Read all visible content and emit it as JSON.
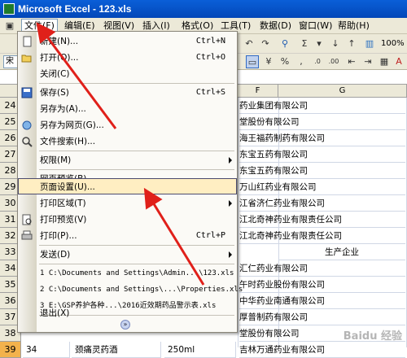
{
  "window": {
    "title": "Microsoft Excel - 123.xls"
  },
  "menubar": {
    "items": [
      {
        "label": "文件(F)"
      },
      {
        "label": "编辑(E)"
      },
      {
        "label": "视图(V)"
      },
      {
        "label": "插入(I)"
      },
      {
        "label": "格式(O)"
      },
      {
        "label": "工具(T)"
      },
      {
        "label": "数据(D)"
      },
      {
        "label": "窗口(W)"
      },
      {
        "label": "帮助(H)"
      }
    ]
  },
  "toolbar": {
    "zoom": "100%",
    "font_name": "宋",
    "sum_symbol": "Σ",
    "percent": "%",
    "comma": ","
  },
  "sheet": {
    "columns": [
      "F",
      "G"
    ],
    "rows": [
      {
        "num": "24",
        "text": "药业集团有限公司"
      },
      {
        "num": "25",
        "text": "堂股份有限公司"
      },
      {
        "num": "26",
        "text": "海王福药制药有限公司"
      },
      {
        "num": "27",
        "text": "东宝五药有限公司"
      },
      {
        "num": "28",
        "text": "东宝五药有限公司"
      },
      {
        "num": "29",
        "text": "万山红药业有限公司"
      },
      {
        "num": "30",
        "text": "江省济仁药业有限公司"
      },
      {
        "num": "31",
        "text": "江北奇神药业有限责任公司"
      },
      {
        "num": "32",
        "text": "江北奇神药业有限责任公司"
      },
      {
        "num": "33",
        "text": "生产企业"
      },
      {
        "num": "34",
        "text": "汇仁药业有限公司"
      },
      {
        "num": "35",
        "text": "午时药业股份有限公司"
      },
      {
        "num": "36",
        "text": "中华药业南通有限公司"
      },
      {
        "num": "37",
        "text": "厚普制药有限公司"
      },
      {
        "num": "38",
        "text": "堂股份有限公司"
      },
      {
        "num": "39",
        "text": "吉林万通药业有限公司"
      }
    ],
    "last_row": {
      "col_a": "34",
      "col_b": "颈痛灵药酒",
      "col_c": "250ml"
    }
  },
  "file_menu": {
    "items": [
      {
        "label": "新建(N)...",
        "shortcut": "Ctrl+N"
      },
      {
        "label": "打开(O)...",
        "shortcut": "Ctrl+O"
      },
      {
        "label": "关闭(C)",
        "shortcut": ""
      },
      {
        "label": "保存(S)",
        "shortcut": "Ctrl+S"
      },
      {
        "label": "另存为(A)...",
        "shortcut": ""
      },
      {
        "label": "另存为网页(G)...",
        "shortcut": ""
      },
      {
        "label": "文件搜索(H)...",
        "shortcut": ""
      },
      {
        "label": "权限(M)",
        "shortcut": ""
      },
      {
        "label": "网页预览(B)",
        "shortcut": ""
      },
      {
        "label": "页面设置(U)...",
        "shortcut": ""
      },
      {
        "label": "打印区域(T)",
        "shortcut": ""
      },
      {
        "label": "打印预览(V)",
        "shortcut": ""
      },
      {
        "label": "打印(P)...",
        "shortcut": "Ctrl+P"
      },
      {
        "label": "发送(D)",
        "shortcut": ""
      },
      {
        "label": "1 C:\\Documents and Settings\\Admin...\\123.xls",
        "shortcut": ""
      },
      {
        "label": "2 C:\\Documents and Settings\\...\\Properties.xls",
        "shortcut": ""
      },
      {
        "label": "3 E:\\GSP养护各种...\\2016近效期药品警示表.xls",
        "shortcut": ""
      },
      {
        "label": "退出(X)",
        "shortcut": ""
      }
    ]
  },
  "watermark": "Baidu 经验",
  "colors": {
    "highlight": "#ffeec2",
    "arrow": "#e0201a",
    "titlebar": "#0a5fd8",
    "selected_row": "#f3b24c"
  }
}
